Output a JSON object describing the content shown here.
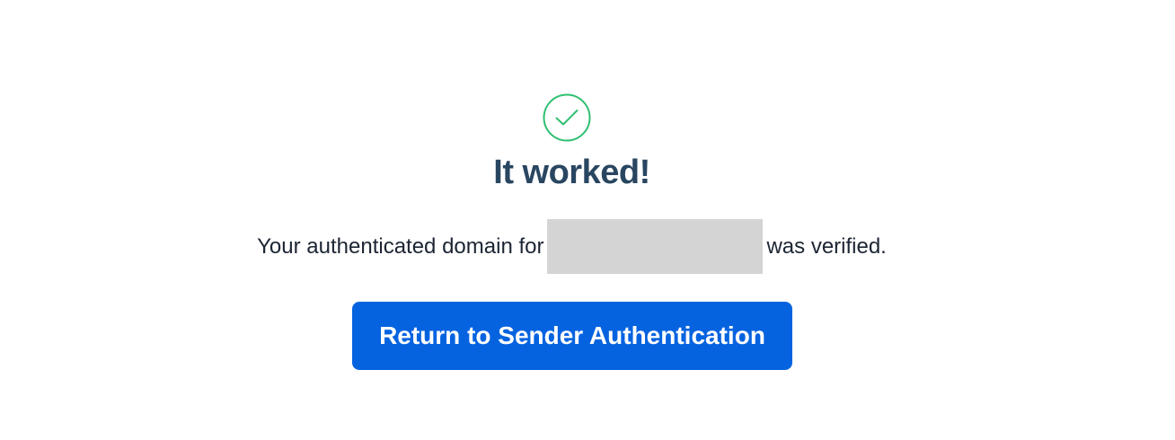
{
  "status": {
    "icon": "check-circle-icon",
    "color": "#2fbf71"
  },
  "title": "It worked!",
  "message": {
    "before": "Your authenticated domain for",
    "after": "was verified."
  },
  "button": {
    "label": "Return to Sender Authentication",
    "color": "#0563e0"
  },
  "colors": {
    "title": "#294661",
    "redaction": "#d4d4d4"
  }
}
